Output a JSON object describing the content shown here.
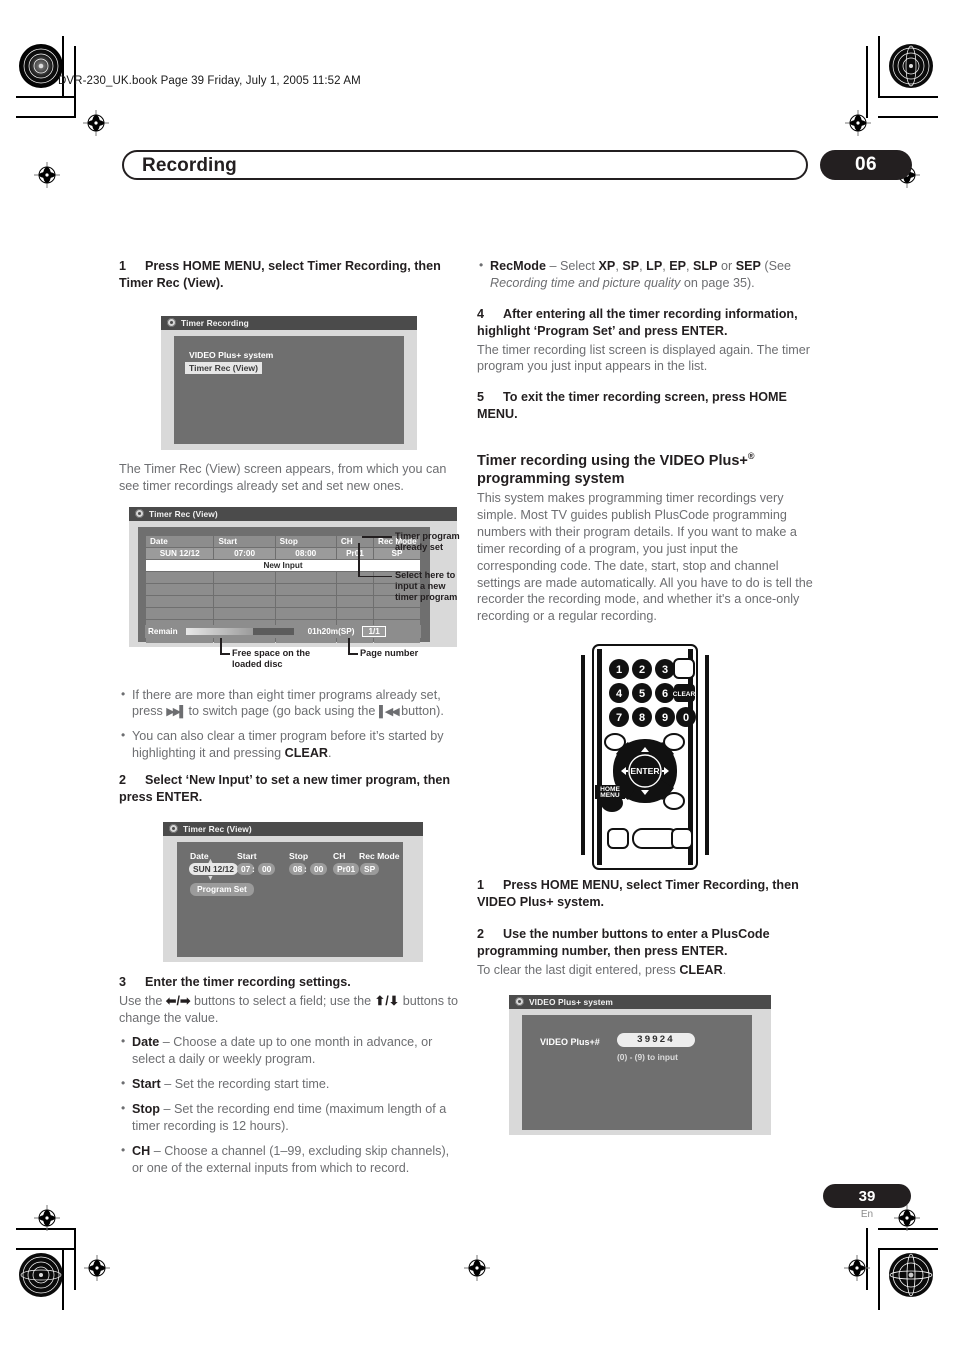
{
  "header": {
    "filepath": "DVR-230_UK.book  Page 39  Friday, July 1, 2005  11:52 AM",
    "chapter_title": "Recording",
    "chapter_number": "06"
  },
  "footer": {
    "page_number": "39",
    "language": "En"
  },
  "left_column": {
    "step1": {
      "num": "1",
      "text": "Press HOME MENU, select Timer Recording, then Timer Rec (View)."
    },
    "screenshot_menu": {
      "title": "Timer Recording",
      "items": [
        {
          "label": "VIDEO Plus+ system",
          "selected": false
        },
        {
          "label": "Timer Rec (View)",
          "selected": true
        }
      ]
    },
    "intro_text": "The Timer Rec (View) screen appears, from which you can see timer recordings already set and set new ones.",
    "screenshot_list": {
      "title": "Timer Rec (View)",
      "columns": [
        "Date",
        "Start",
        "Stop",
        "CH",
        "Rec Mode"
      ],
      "rows": [
        [
          "SUN 12/12",
          "07:00",
          "08:00",
          "Pr01",
          "SP"
        ]
      ],
      "new_input_label": "New Input",
      "empty_rows": 6,
      "remain_label": "Remain",
      "remain_value": "01h20m(SP)",
      "page_indicator": "1/1",
      "meter_fill_percent": 42,
      "callouts": [
        "Timer program already set",
        "Select here to input a new timer program",
        "Free space on the loaded disc",
        "Page number"
      ]
    },
    "bullets_after_list": [
      "If there are more than eight timer programs already set, press ▶▶| to switch page (go back using the |◀◀ button).",
      "You can also clear a timer program before it’s started by highlighting it and pressing CLEAR."
    ],
    "step2": {
      "num": "2",
      "text": "Select ‘New Input’ to set a new timer program, then press ENTER."
    },
    "screenshot_programset": {
      "title": "Timer Rec (View)",
      "labels": [
        "Date",
        "Start",
        "Stop",
        "CH",
        "Rec Mode"
      ],
      "date_value": "SUN 12/12",
      "start_hour": "07",
      "start_min": "00",
      "stop_hour": "08",
      "stop_min": "00",
      "ch_value": "Pr01",
      "recmode_value": "SP",
      "button_label": "Program Set"
    },
    "step3": {
      "num": "3",
      "title": "Enter the timer recording settings.",
      "text": "Use the ⬅/➡ buttons to select a field; use the ⬆/⬇ buttons to change the value."
    },
    "step3_bullets": [
      {
        "term": "Date",
        "desc": " – Choose a date up to one month in advance, or select a daily or weekly program."
      },
      {
        "term": "Start",
        "desc": " – Set the recording start time."
      },
      {
        "term": "Stop",
        "desc": " – Set the recording end time (maximum length of a timer recording is 12 hours)."
      },
      {
        "term": "CH",
        "desc": " – Choose a channel (1–99, excluding skip channels), or one of the external inputs from which to record."
      }
    ]
  },
  "right_column": {
    "recmode_bullet": {
      "term": "RecMode",
      "pre": " – Select ",
      "modes": [
        "XP",
        "SP",
        "LP",
        "EP",
        "SLP",
        "SEP"
      ],
      "post_see": " (See ",
      "italic_ref": "Recording time and picture quality",
      "post_page": " on page 35)."
    },
    "step4": {
      "num": "4",
      "title": "After entering all the timer recording information, highlight ‘Program Set’ and press ENTER.",
      "text": "The timer recording list screen is displayed again. The timer program you just input appears in the list."
    },
    "step5": {
      "num": "5",
      "title": "To exit the timer recording screen, press HOME MENU."
    },
    "section": {
      "heading_line1": "Timer recording using the VIDEO Plus+",
      "heading_sup": "®",
      "heading_line2": "programming system",
      "body": "This system makes programming timer recordings very simple. Most TV guides publish PlusCode programming numbers with their program details. If you want to make a timer recording of a program, you just input the corresponding code. The date, start, stop and channel settings are made automatically. All you have to do is tell the recorder the recording mode, and whether it's a once-only recording or a regular recording."
    },
    "remote": {
      "number_keys": [
        "1",
        "2",
        "3",
        "4",
        "5",
        "6",
        "7",
        "8",
        "9",
        "0"
      ],
      "clear_label": "CLEAR",
      "enter_label": "ENTER",
      "home_menu_label": "HOME MENU"
    },
    "step1b": {
      "num": "1",
      "text": "Press HOME MENU, select Timer Recording, then VIDEO Plus+ system."
    },
    "step2b": {
      "num": "2",
      "title": "Use the number buttons to enter a PlusCode programming number, then press ENTER.",
      "text": "To clear the last digit entered, press CLEAR."
    },
    "screenshot_videoplus": {
      "title": "VIDEO Plus+ system",
      "field_label": "VIDEO Plus+#",
      "field_value": "39924",
      "hint": "(0) - (9) to input"
    }
  },
  "colors": {
    "osd_title_bar": "#4b4b4b",
    "osd_body": "#6f6f6f",
    "osd_frame": "#d9d9d9",
    "table_cell": "#8d8d8d",
    "highlight": "#e6e6e6",
    "ink": "#231f20",
    "body_gray": "#6d6e71"
  }
}
